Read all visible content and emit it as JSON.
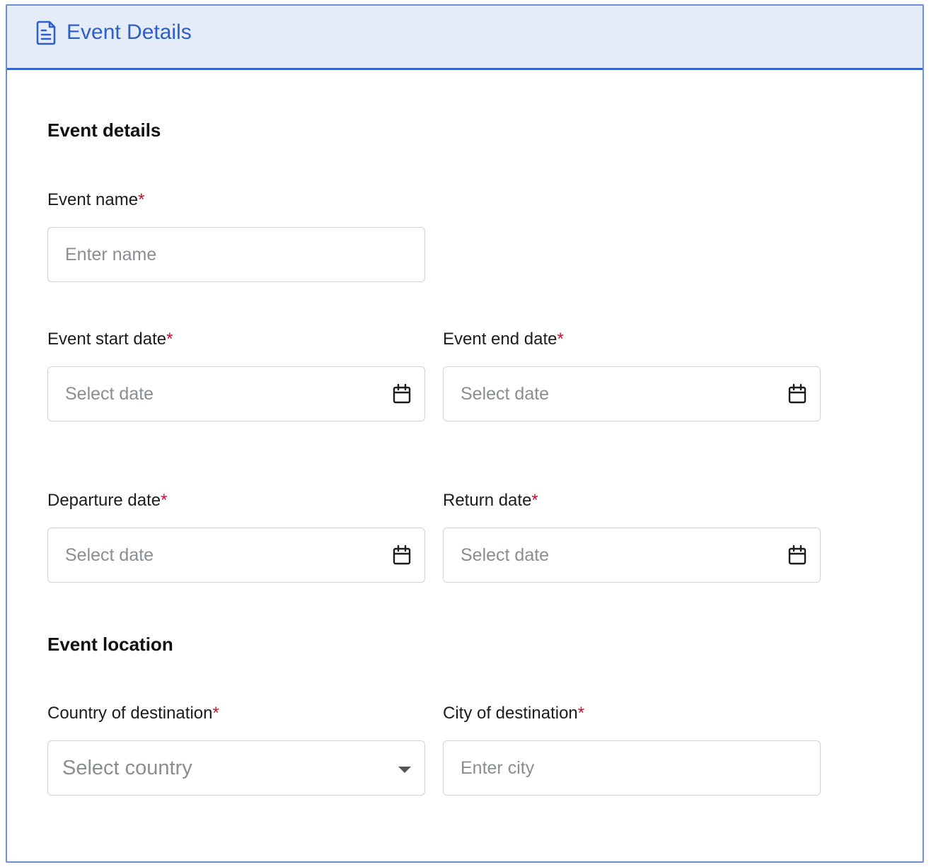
{
  "header": {
    "title": "Event Details",
    "icon": "document-icon",
    "accent": "#2f5ec8"
  },
  "sections": {
    "details_title": "Event details",
    "location_title": "Event location"
  },
  "fields": {
    "event_name": {
      "label": "Event name",
      "required": "*",
      "placeholder": "Enter name"
    },
    "start_date": {
      "label": "Event start date",
      "required": "*",
      "placeholder": "Select date",
      "icon": "calendar-icon"
    },
    "end_date": {
      "label": "Event end date",
      "required": "*",
      "placeholder": "Select date",
      "icon": "calendar-icon"
    },
    "departure_date": {
      "label": "Departure date",
      "required": "*",
      "placeholder": "Select date",
      "icon": "calendar-icon"
    },
    "return_date": {
      "label": "Return date",
      "required": "*",
      "placeholder": "Select date",
      "icon": "calendar-icon"
    },
    "country": {
      "label": "Country of destination",
      "required": "*",
      "placeholder": "Select country",
      "icon": "chevron-down-icon"
    },
    "city": {
      "label": "City of destination",
      "required": "*",
      "placeholder": "Enter city"
    }
  },
  "colors": {
    "required": "#c8102e",
    "header_bg": "#e4ecf7",
    "border": "#6a8fd4"
  }
}
